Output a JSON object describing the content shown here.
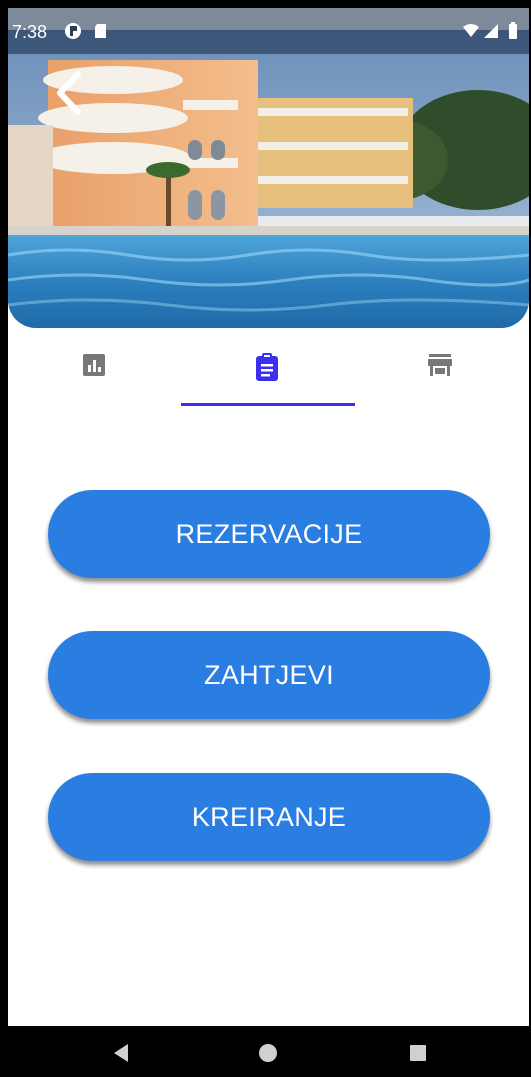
{
  "status_bar": {
    "time": "7:38"
  },
  "header": {
    "back_icon": "chevron-left-icon",
    "image_subject": "hotel with pool"
  },
  "tabs": [
    {
      "icon": "bar-chart-icon",
      "selected": false
    },
    {
      "icon": "clipboard-icon",
      "selected": true
    },
    {
      "icon": "store-icon",
      "selected": false
    }
  ],
  "actions": {
    "reservations_label": "REZERVACIJE",
    "requests_label": "ZAHTJEVI",
    "create_label": "KREIRANJE"
  },
  "nav": {
    "back": "back-triangle-icon",
    "home": "home-circle-icon",
    "recents": "recents-square-icon"
  },
  "colors": {
    "accent": "#3d2ff0",
    "button": "#2a7de1",
    "tab_inactive": "#777777"
  }
}
